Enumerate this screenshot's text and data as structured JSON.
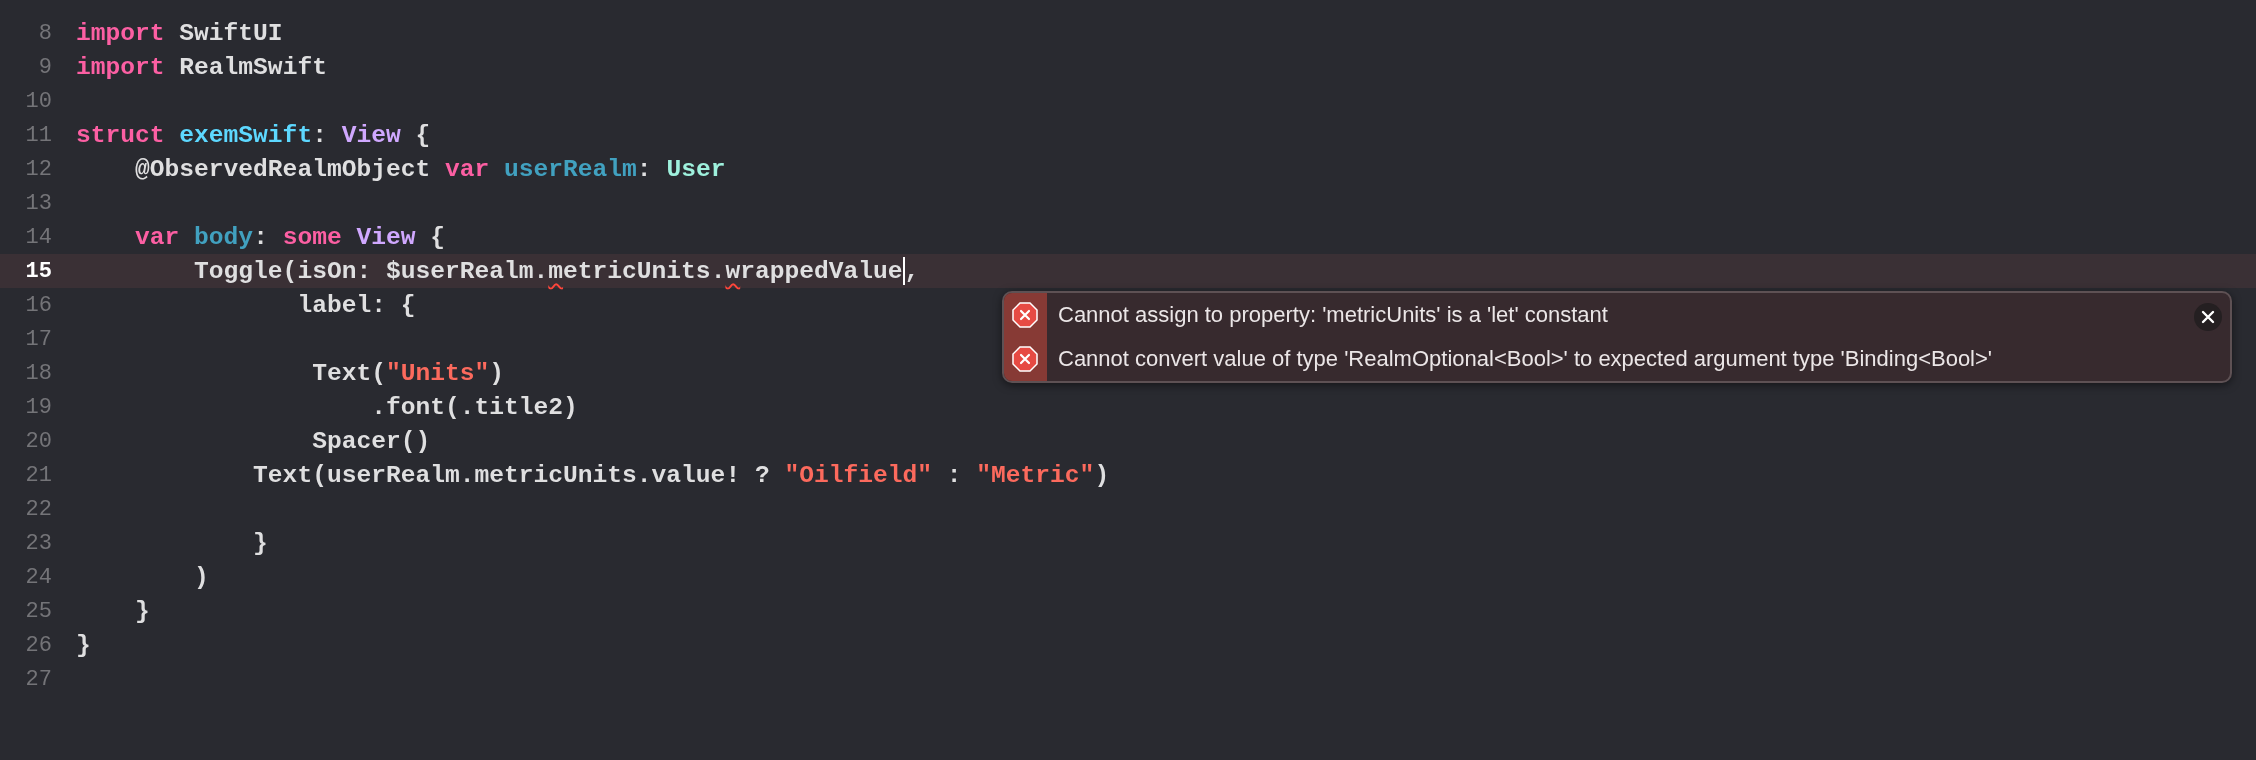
{
  "editor": {
    "lines": [
      {
        "number": "8",
        "current": false,
        "tokens": [
          {
            "text": "import",
            "kind": "keyword"
          },
          {
            "text": " SwiftUI",
            "kind": "plain"
          }
        ]
      },
      {
        "number": "9",
        "current": false,
        "tokens": [
          {
            "text": "import",
            "kind": "keyword"
          },
          {
            "text": " RealmSwift",
            "kind": "plain"
          }
        ]
      },
      {
        "number": "10",
        "current": false
      },
      {
        "number": "11",
        "current": false,
        "tokens": [
          {
            "text": "struct ",
            "kind": "keyword"
          },
          {
            "text": "exemSwift",
            "kind": "declaration"
          },
          {
            "text": ": ",
            "kind": "plain"
          },
          {
            "text": "View",
            "kind": "type"
          },
          {
            "text": " {",
            "kind": "plain"
          }
        ]
      },
      {
        "number": "12",
        "current": false,
        "tokens": [
          {
            "text": "    @ObservedRealmObject ",
            "kind": "plain"
          },
          {
            "text": "var ",
            "kind": "keyword"
          },
          {
            "text": "userRealm",
            "kind": "variable"
          },
          {
            "text": ": ",
            "kind": "plain"
          },
          {
            "text": "User",
            "kind": "project_type"
          }
        ]
      },
      {
        "number": "13",
        "current": false
      },
      {
        "number": "14",
        "current": false,
        "tokens": [
          {
            "text": "    var ",
            "kind": "keyword"
          },
          {
            "text": "body",
            "kind": "variable"
          },
          {
            "text": ": ",
            "kind": "plain"
          },
          {
            "text": "some ",
            "kind": "keyword"
          },
          {
            "text": "View",
            "kind": "type"
          },
          {
            "text": " {",
            "kind": "plain"
          }
        ]
      },
      {
        "number": "15",
        "current": true,
        "tokens": [
          {
            "text": "        Toggle(isOn: $userRealm.",
            "kind": "plain"
          },
          {
            "text": "m",
            "kind": "flagged"
          },
          {
            "text": "etricUnits.",
            "kind": "plain"
          },
          {
            "text": "w",
            "kind": "flagged"
          },
          {
            "text": "rappedValue",
            "kind": "plain"
          },
          {
            "kind": "caret"
          },
          {
            "text": ",",
            "kind": "plain"
          }
        ]
      },
      {
        "number": "16",
        "current": false,
        "tokens": [
          {
            "text": "               label: {",
            "kind": "plain"
          }
        ]
      },
      {
        "number": "17",
        "current": false
      },
      {
        "number": "18",
        "current": false,
        "tokens": [
          {
            "text": "                Text(",
            "kind": "plain"
          },
          {
            "text": "\"Units\"",
            "kind": "string"
          },
          {
            "text": ")",
            "kind": "plain"
          }
        ]
      },
      {
        "number": "19",
        "current": false,
        "tokens": [
          {
            "text": "                    .font(.title2)",
            "kind": "plain"
          }
        ]
      },
      {
        "number": "20",
        "current": false,
        "tokens": [
          {
            "text": "                Spacer()",
            "kind": "plain"
          }
        ]
      },
      {
        "number": "21",
        "current": false,
        "tokens": [
          {
            "text": "            Text(userRealm.metricUnits.value! ? ",
            "kind": "plain"
          },
          {
            "text": "\"Oilfield\"",
            "kind": "string"
          },
          {
            "text": " : ",
            "kind": "plain"
          },
          {
            "text": "\"Metric\"",
            "kind": "string"
          },
          {
            "text": ")",
            "kind": "plain"
          }
        ]
      },
      {
        "number": "22",
        "current": false
      },
      {
        "number": "23",
        "current": false,
        "tokens": [
          {
            "text": "            }",
            "kind": "plain"
          }
        ]
      },
      {
        "number": "24",
        "current": false,
        "tokens": [
          {
            "text": "        )",
            "kind": "plain"
          }
        ]
      },
      {
        "number": "25",
        "current": false,
        "tokens": [
          {
            "text": "    }",
            "kind": "plain"
          }
        ]
      },
      {
        "number": "26",
        "current": false,
        "tokens": [
          {
            "text": "}",
            "kind": "plain"
          }
        ]
      },
      {
        "number": "27",
        "current": false
      }
    ]
  },
  "issue_popover": {
    "messages": [
      {
        "kind": "error",
        "text": "Cannot assign to property: 'metricUnits' is a 'let' constant"
      },
      {
        "kind": "error",
        "text": "Cannot convert value of type 'RealmOptional<Bool>' to expected argument type 'Binding<Bool>'"
      }
    ]
  }
}
